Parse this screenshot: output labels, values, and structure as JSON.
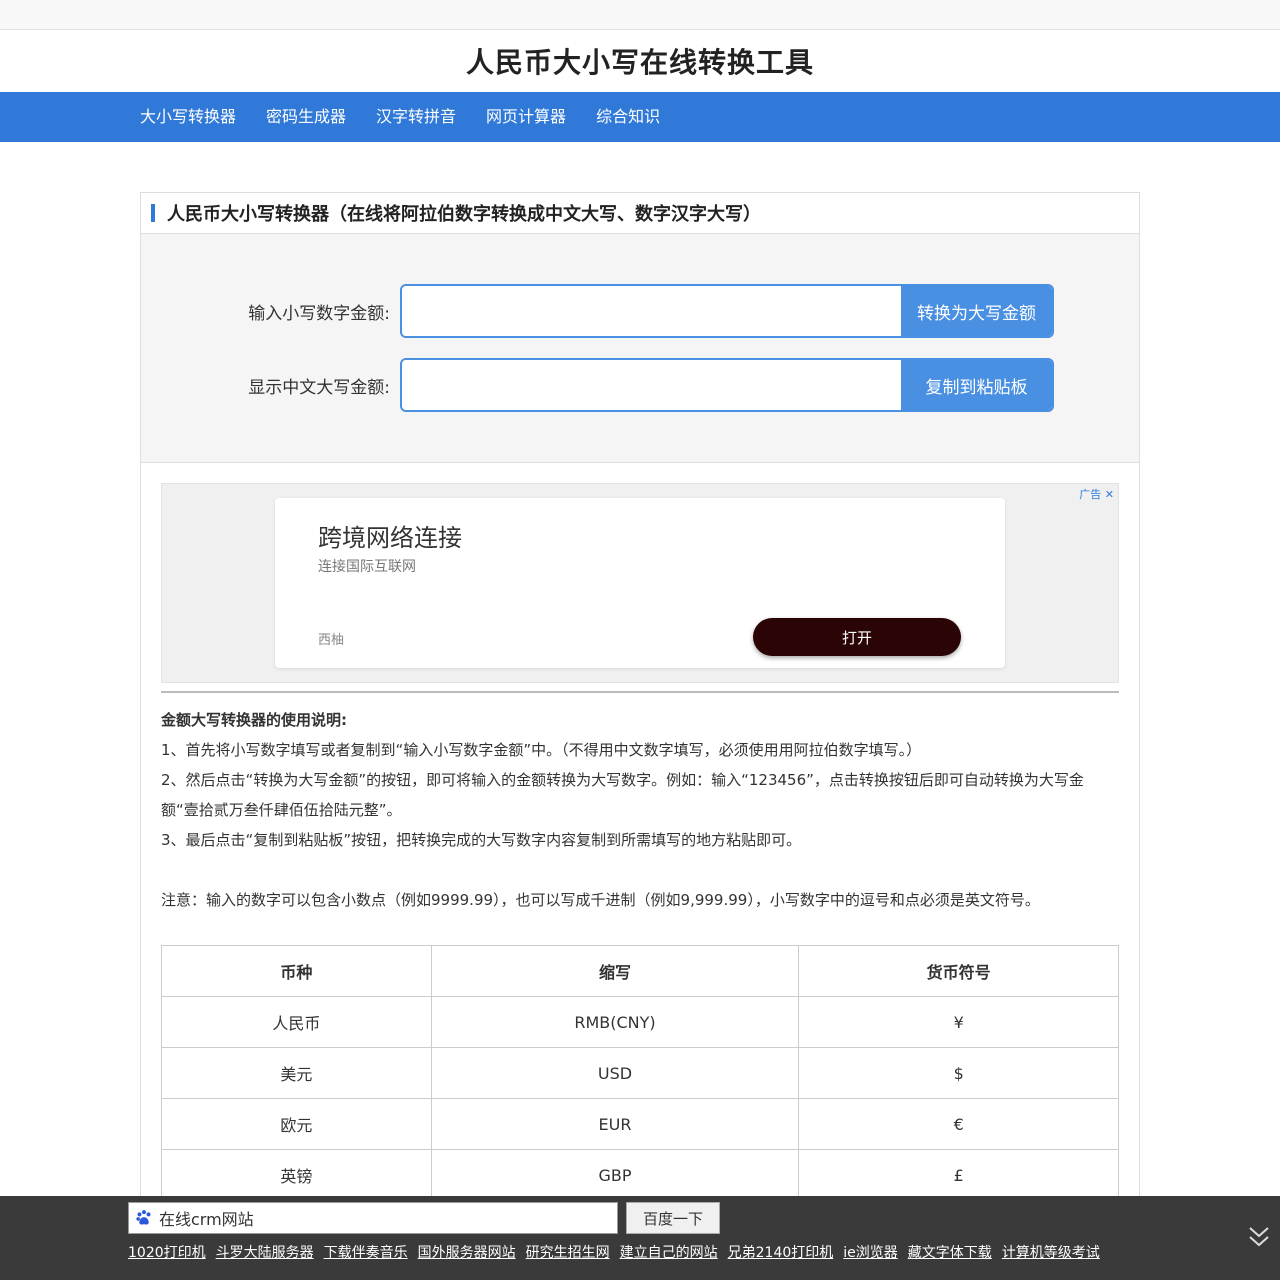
{
  "site": {
    "title": "人民币大小写在线转换工具"
  },
  "nav": {
    "items": [
      "大小写转换器",
      "密码生成器",
      "汉字转拼音",
      "网页计算器",
      "综合知识"
    ]
  },
  "card": {
    "title": "人民币大小写转换器（在线将阿拉伯数字转换成中文大写、数字汉字大写）"
  },
  "converter": {
    "input_label": "输入小写数字金额:",
    "input_value": "",
    "convert_button": "转换为大写金额",
    "output_label": "显示中文大写金额:",
    "output_value": "",
    "copy_button": "复制到粘贴板"
  },
  "ad": {
    "mark": "广告",
    "title": "跨境网络连接",
    "subtitle": "连接国际互联网",
    "brand": "西柚",
    "button": "打开"
  },
  "instructions": {
    "heading": "金额大写转换器的使用说明:",
    "steps": [
      "1、首先将小写数字填写或者复制到“输入小写数字金额”中。（不得用中文数字填写，必须使用用阿拉伯数字填写。）",
      "2、然后点击“转换为大写金额”的按钮，即可将输入的金额转换为大写数字。例如：输入“123456”，点击转换按钮后即可自动转换为大写金额“壹拾贰万叁仟肆佰伍拾陆元整”。",
      "3、最后点击“复制到粘贴板”按钮，把转换完成的大写数字内容复制到所需填写的地方粘贴即可。"
    ],
    "note": "注意：输入的数字可以包含小数点（例如9999.99），也可以写成千进制（例如9,999.99），小写数字中的逗号和点必须是英文符号。"
  },
  "currency_table": {
    "headers": [
      "币种",
      "缩写",
      "货币符号"
    ],
    "rows": [
      [
        "人民币",
        "RMB(CNY)",
        "¥"
      ],
      [
        "美元",
        "USD",
        "$"
      ],
      [
        "欧元",
        "EUR",
        "€"
      ],
      [
        "英镑",
        "GBP",
        "£"
      ]
    ]
  },
  "bottom_bar": {
    "search_value": "在线crm网站",
    "search_button": "百度一下",
    "links": [
      "1020打印机",
      "斗罗大陆服务器",
      "下载伴奏音乐",
      "国外服务器网站",
      "研究生招生网",
      "建立自己的网站",
      "兄弟2140打印机",
      "ie浏览器",
      "藏文字体下载",
      "计算机等级考试"
    ]
  },
  "colors": {
    "accent": "#3079d8",
    "button": "#4a90e2",
    "ad_button": "#2b0505"
  }
}
